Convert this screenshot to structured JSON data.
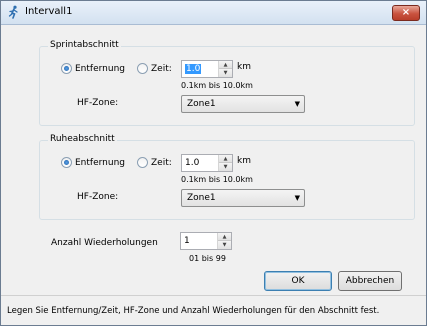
{
  "window": {
    "title": "Intervall1",
    "close_label": "×"
  },
  "sprint": {
    "group_label": "Sprintabschnitt",
    "radio_distance_label": "Entfernung",
    "radio_time_label": "Zeit:",
    "selected": "distance",
    "value": "1.0",
    "unit": "km",
    "range_hint": "0.1km bis 10.0km",
    "hr_zone_label": "HF-Zone:",
    "hr_zone_value": "Zone1"
  },
  "rest": {
    "group_label": "Ruheabschnitt",
    "radio_distance_label": "Entfernung",
    "radio_time_label": "Zeit:",
    "selected": "distance",
    "value": "1.0",
    "unit": "km",
    "range_hint": "0.1km bis 10.0km",
    "hr_zone_label": "HF-Zone:",
    "hr_zone_value": "Zone1"
  },
  "repetitions": {
    "label": "Anzahl Wiederholungen",
    "value": "1",
    "range_hint": "01 bis 99"
  },
  "buttons": {
    "ok_label": "OK",
    "cancel_label": "Abbrechen"
  },
  "status": {
    "text": "Legen Sie Entfernung/Zeit, HF-Zone und Anzahl Wiederholungen für den Abschnitt fest."
  },
  "colors": {
    "close_button": "#c9533f",
    "selection": "#3399ff"
  }
}
